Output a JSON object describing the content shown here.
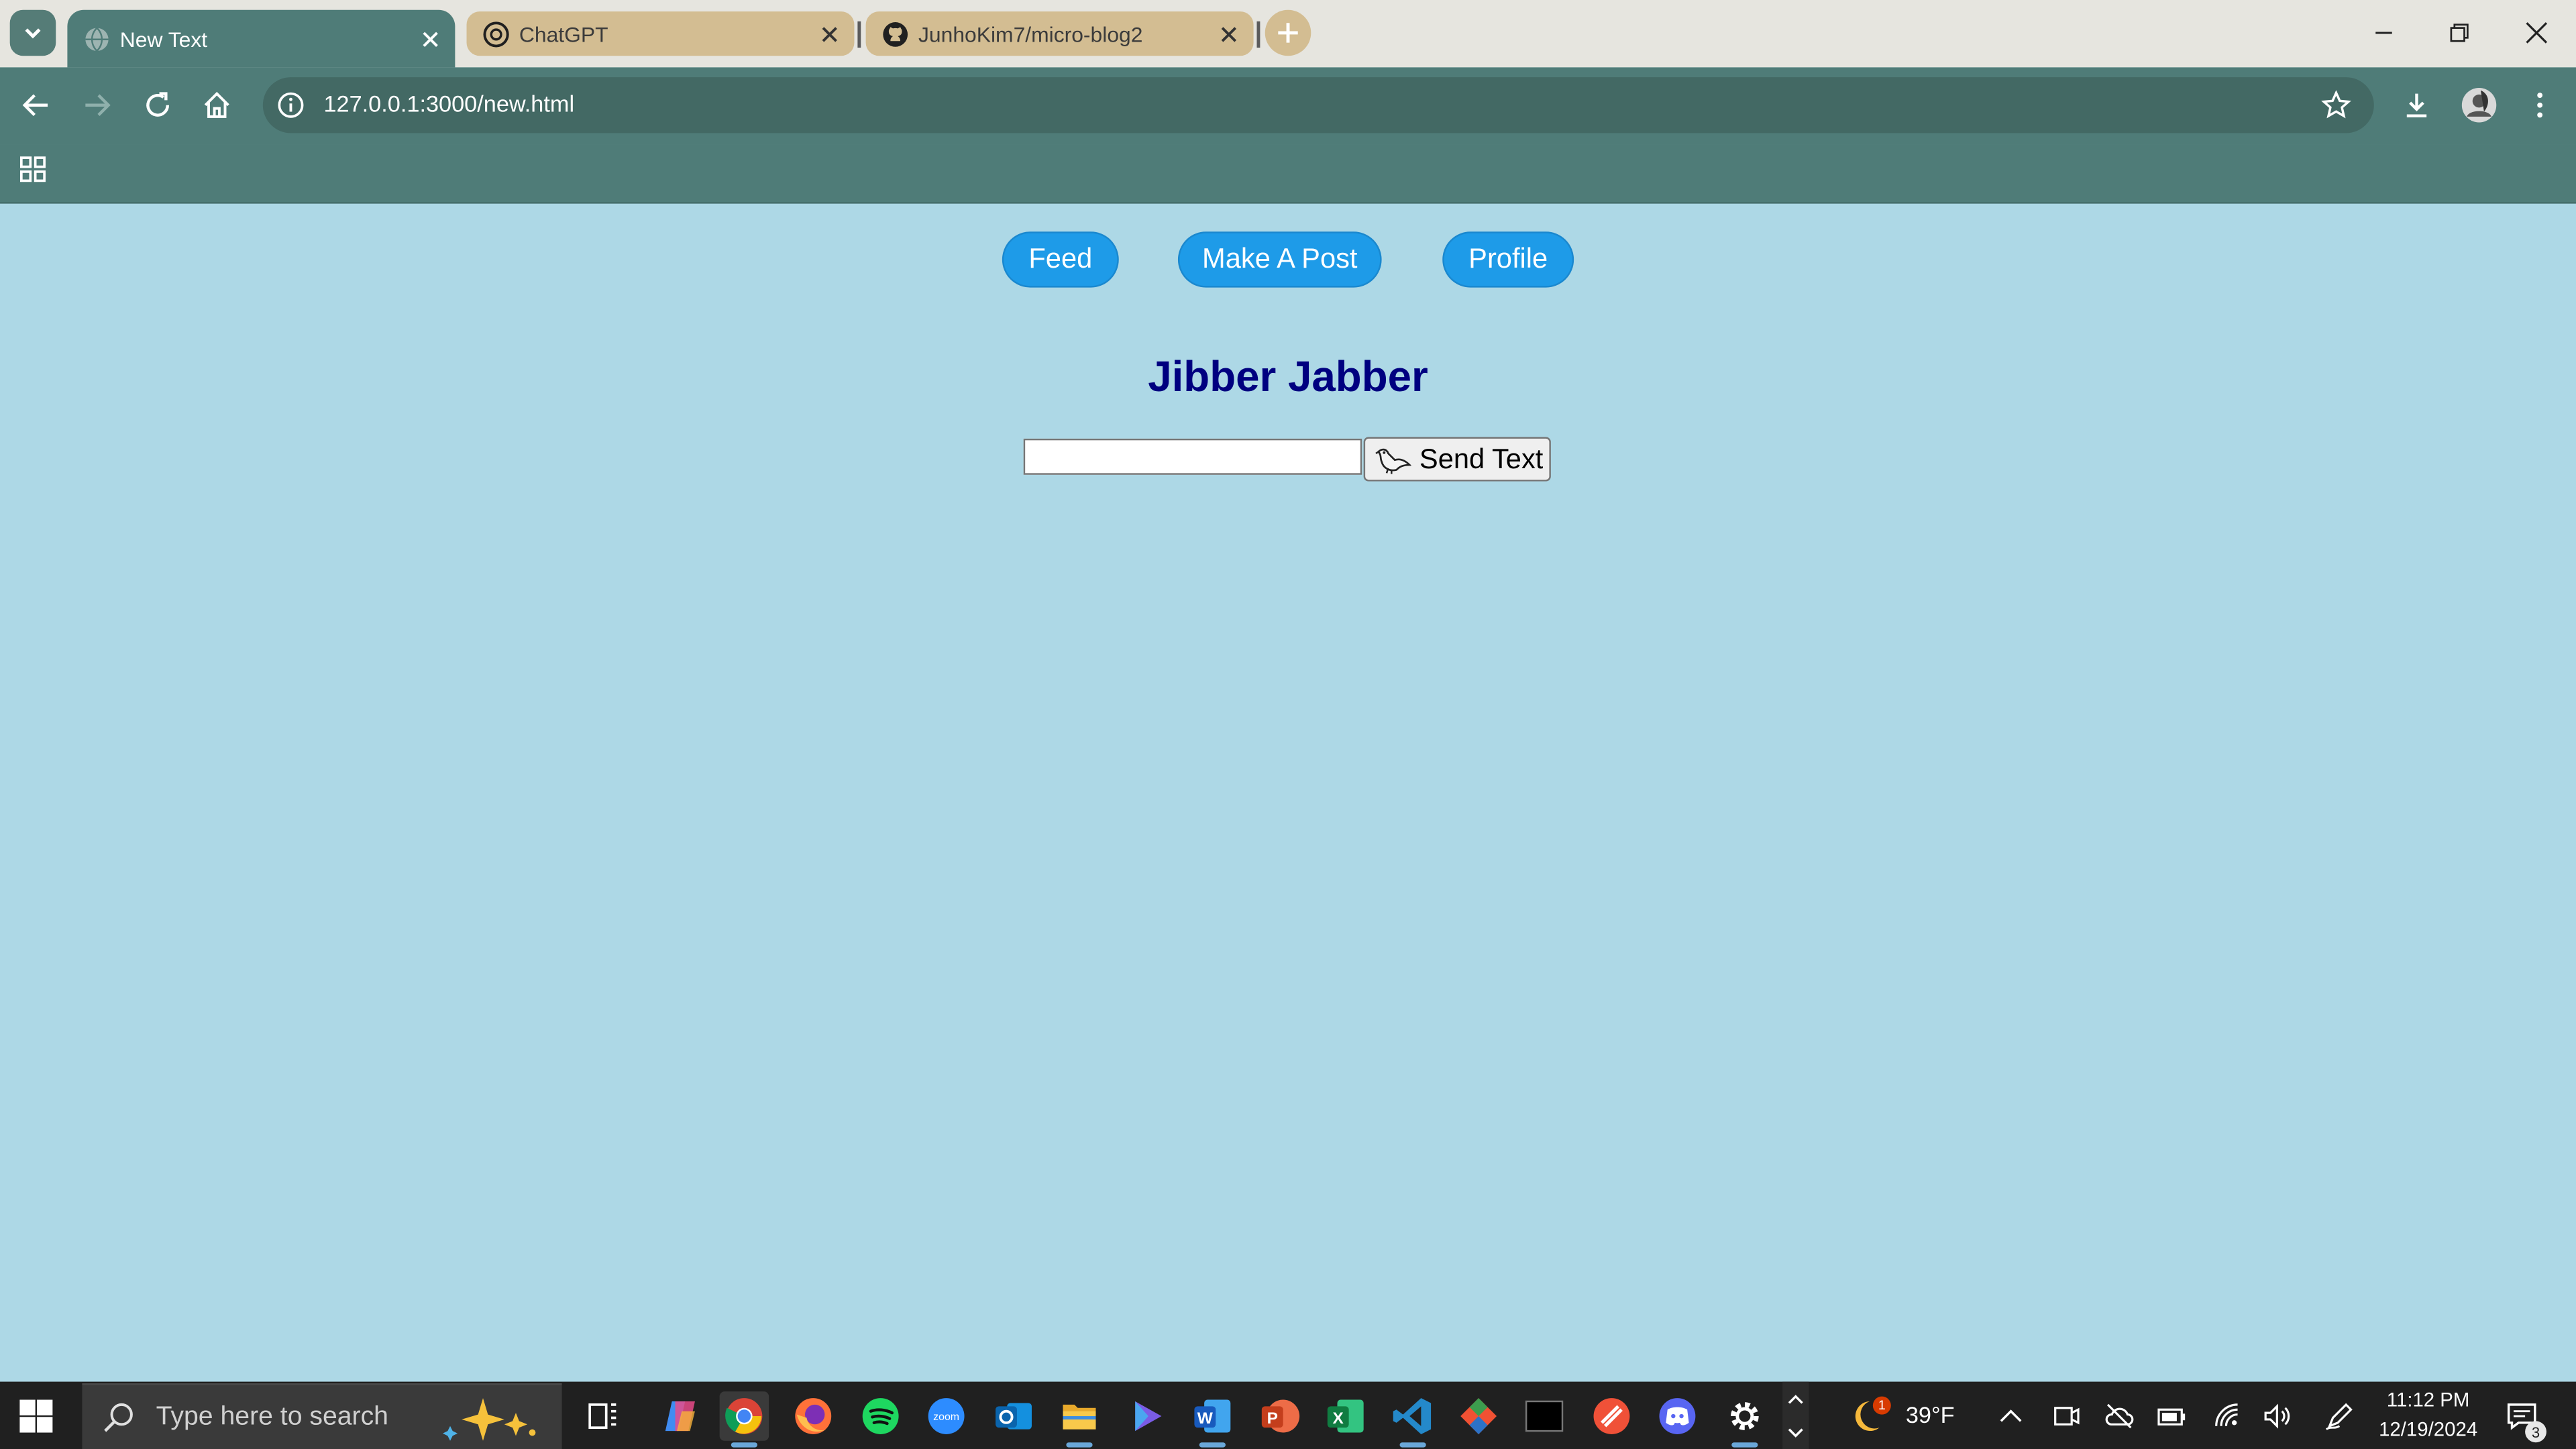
{
  "browser": {
    "tabs": [
      {
        "title": "New Text",
        "active": true,
        "favicon": "globe-icon"
      },
      {
        "title": "ChatGPT",
        "active": false,
        "favicon": "openai-icon"
      },
      {
        "title": "JunhoKim7/micro-blog2",
        "active": false,
        "favicon": "github-icon"
      }
    ],
    "url": "127.0.0.1:3000/new.html",
    "colors": {
      "frame": "#e6e5df",
      "toolbar": "#4f7c78",
      "omnibox": "#436964",
      "inactive_tab": "#d3bd92"
    }
  },
  "page": {
    "background": "#add8e6",
    "nav": [
      {
        "label": "Feed"
      },
      {
        "label": "Make A Post"
      },
      {
        "label": "Profile"
      }
    ],
    "nav_color": "#1e9be8",
    "heading": "Jibber Jabber",
    "heading_color": "#000080",
    "text_input": {
      "value": "",
      "placeholder": ""
    },
    "send_button": {
      "label": "Send Text",
      "icon": "bird-icon"
    }
  },
  "taskbar": {
    "search_placeholder": "Type here to search",
    "pinned_apps": [
      "task-view-icon",
      "copilot-icon",
      "chrome-icon",
      "firefox-icon",
      "spotify-icon",
      "zoom-icon",
      "outlook-icon",
      "file-explorer-icon",
      "clipchamp-icon",
      "word-icon",
      "powerpoint-icon",
      "excel-icon",
      "vscode-icon",
      "git-icon",
      "terminal-icon",
      "swift-icon",
      "discord-icon",
      "settings-icon"
    ],
    "weather": {
      "temp": "39°F",
      "badge": "1"
    },
    "clock": {
      "time": "11:12 PM",
      "date": "12/19/2024"
    },
    "notification_count": "3"
  }
}
